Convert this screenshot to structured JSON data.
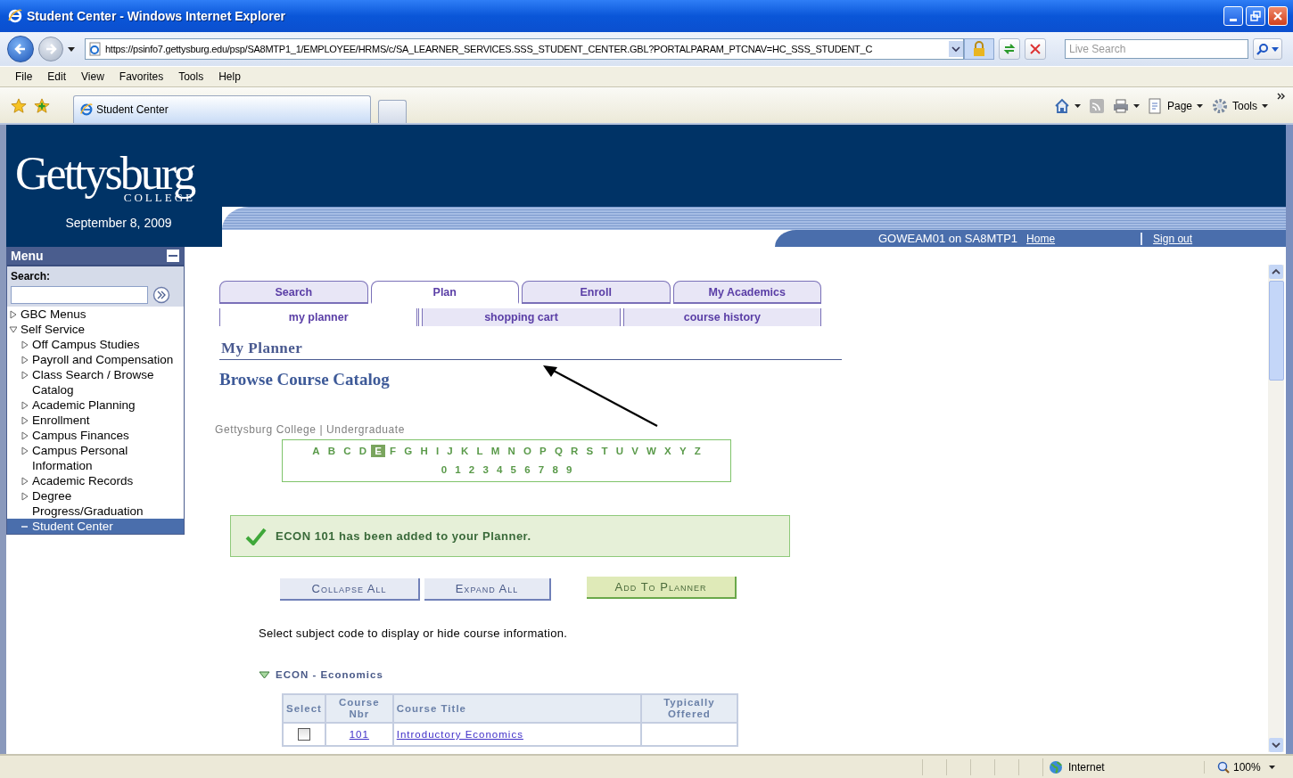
{
  "window": {
    "title": "Student Center - Windows Internet Explorer"
  },
  "address_bar": {
    "url": "https://psinfo7.gettysburg.edu/psp/SA8MTP1_1/EMPLOYEE/HRMS/c/SA_LEARNER_SERVICES.SSS_STUDENT_CENTER.GBL?PORTALPARAM_PTCNAV=HC_SSS_STUDENT_C",
    "search_placeholder": "Live Search"
  },
  "menu_bar": [
    "File",
    "Edit",
    "View",
    "Favorites",
    "Tools",
    "Help"
  ],
  "browser_tabs": [
    {
      "label": "Student Center",
      "selected": true
    }
  ],
  "command_bar": [
    {
      "kind": "home"
    },
    {
      "kind": "feeds"
    },
    {
      "kind": "print"
    },
    {
      "kind": "page",
      "label": "Page"
    },
    {
      "kind": "tools",
      "label": "Tools"
    }
  ],
  "header": {
    "logo": "Gettysburg",
    "logo_sub": "COLLEGE",
    "date": "September 8, 2009",
    "user": "GOWEAM01 on SA8MTP1",
    "links": [
      "Home",
      "Sign out"
    ]
  },
  "menu": {
    "title": "Menu",
    "search_label": "Search:",
    "items": [
      {
        "label": "GBC Menus",
        "kind": "folder",
        "expanded": false,
        "selected": false
      },
      {
        "label": "Self Service",
        "kind": "folder",
        "expanded": true,
        "selected": false,
        "children": [
          {
            "label": "Off Campus Studies",
            "kind": "folder",
            "expanded": false,
            "selected": false
          },
          {
            "label": "Payroll and Compensation",
            "kind": "folder",
            "expanded": false,
            "selected": false
          },
          {
            "label": "Class Search / Browse Catalog",
            "kind": "folder",
            "expanded": false,
            "selected": false
          },
          {
            "label": "Academic Planning",
            "kind": "folder",
            "expanded": false,
            "selected": false
          },
          {
            "label": "Enrollment",
            "kind": "folder",
            "expanded": false,
            "selected": false
          },
          {
            "label": "Campus Finances",
            "kind": "folder",
            "expanded": false,
            "selected": false
          },
          {
            "label": "Campus Personal Information",
            "kind": "folder",
            "expanded": false,
            "selected": false
          },
          {
            "label": "Academic Records",
            "kind": "folder",
            "expanded": false,
            "selected": false
          },
          {
            "label": "Degree Progress/Graduation",
            "kind": "folder",
            "expanded": false,
            "selected": false
          },
          {
            "label": "Student Center",
            "kind": "page",
            "selected": true
          }
        ]
      }
    ]
  },
  "tabs": [
    {
      "label": "Search",
      "selected": false
    },
    {
      "label": "Plan",
      "selected": true
    },
    {
      "label": "Enroll",
      "selected": false
    },
    {
      "label": "My Academics",
      "selected": false
    }
  ],
  "subtabs": [
    {
      "label": "my planner",
      "selected": true
    },
    {
      "label": "shopping cart",
      "selected": false
    },
    {
      "label": "course history",
      "selected": false
    }
  ],
  "page_title": "My Planner",
  "section_title": "Browse Course Catalog",
  "breadcrumb": "Gettysburg College | Undergraduate",
  "letters": [
    {
      "label": "A",
      "selected": false
    },
    {
      "label": "B",
      "selected": false
    },
    {
      "label": "C",
      "selected": false
    },
    {
      "label": "D",
      "selected": false
    },
    {
      "label": "E",
      "selected": true
    },
    {
      "label": "F",
      "selected": false
    },
    {
      "label": "G",
      "selected": false
    },
    {
      "label": "H",
      "selected": false
    },
    {
      "label": "I",
      "selected": false
    },
    {
      "label": "J",
      "selected": false
    },
    {
      "label": "K",
      "selected": false
    },
    {
      "label": "L",
      "selected": false
    },
    {
      "label": "M",
      "selected": false
    },
    {
      "label": "N",
      "selected": false
    },
    {
      "label": "O",
      "selected": false
    },
    {
      "label": "P",
      "selected": false
    },
    {
      "label": "Q",
      "selected": false
    },
    {
      "label": "R",
      "selected": false
    },
    {
      "label": "S",
      "selected": false
    },
    {
      "label": "T",
      "selected": false
    },
    {
      "label": "U",
      "selected": false
    },
    {
      "label": "V",
      "selected": false
    },
    {
      "label": "W",
      "selected": false
    },
    {
      "label": "X",
      "selected": false
    },
    {
      "label": "Y",
      "selected": false
    },
    {
      "label": "Z",
      "selected": false
    }
  ],
  "digits": [
    "0",
    "1",
    "2",
    "3",
    "4",
    "5",
    "6",
    "7",
    "8",
    "9"
  ],
  "message": "ECON 101 has been added to your Planner.",
  "buttons": [
    {
      "label": "Collapse All",
      "kind": "plain"
    },
    {
      "label": "Expand All",
      "kind": "plain"
    },
    {
      "label": "Add To Planner",
      "kind": "primary"
    }
  ],
  "instruction": "Select subject code to display or hide course information.",
  "subject": {
    "label": "ECON - Economics",
    "expanded": true
  },
  "table": {
    "columns": [
      "Select",
      "Course Nbr",
      "Course Title",
      "Typically Offered"
    ],
    "rows": [
      {
        "checked": false,
        "nbr": "101",
        "title": "Introductory Economics"
      }
    ]
  },
  "status_bar": {
    "zone": "Internet",
    "zoom": "100%"
  }
}
